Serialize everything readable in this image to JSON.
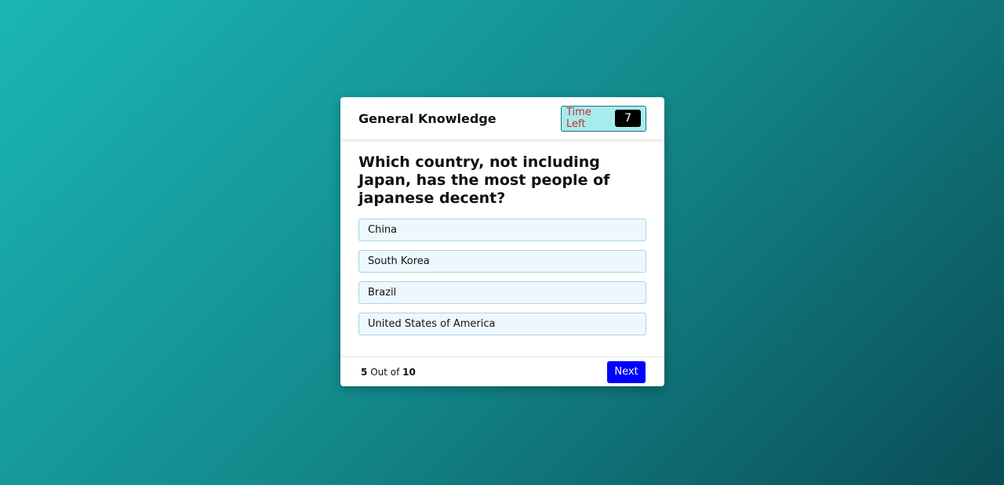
{
  "quiz": {
    "title": "General Knowledge",
    "timer_label": "Time Left",
    "timer_value": "7",
    "question": "Which country, not including Japan, has the most people of japanese decent?",
    "options": [
      "China",
      "South Korea",
      "Brazil",
      "United States of America"
    ],
    "progress": {
      "current": "5",
      "separator": "Out of",
      "total": "10"
    },
    "next_label": "Next"
  },
  "colors": {
    "background_start": "#1bb6b6",
    "background_end": "#0a4d56",
    "timer_bg": "#a7ecec",
    "timer_label": "#d12a2a",
    "option_bg": "#eef7fd",
    "next_button": "#0000ff"
  }
}
